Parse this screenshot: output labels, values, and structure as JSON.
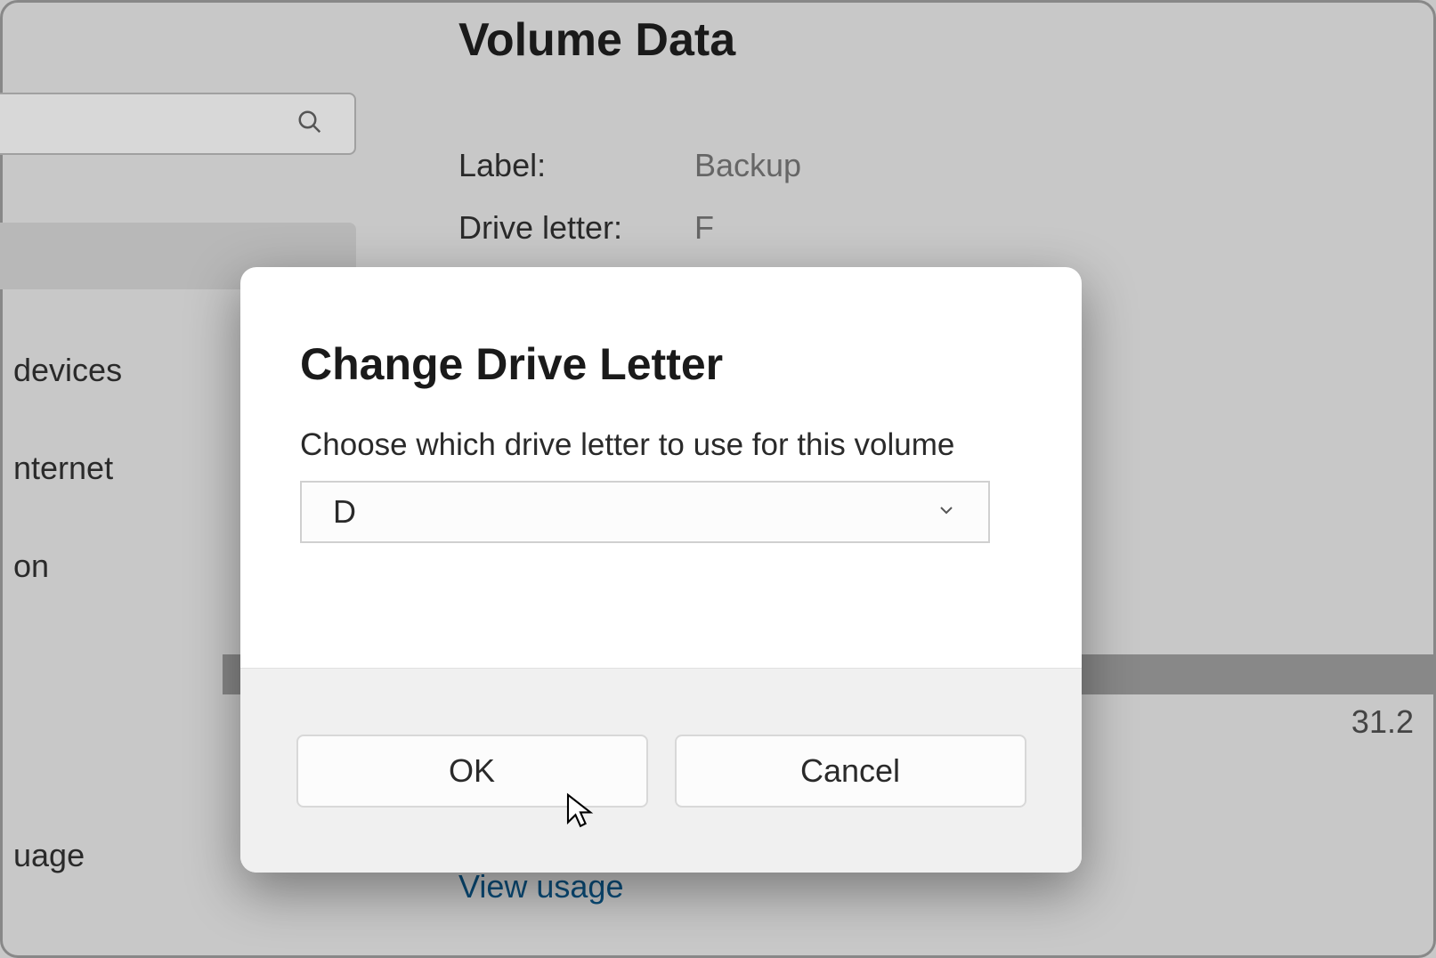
{
  "page": {
    "title": "Volume Data",
    "label_field": "Label:",
    "label_value": "Backup",
    "drive_letter_field": "Drive letter:",
    "drive_letter_value": "F",
    "view_usage_link": "View usage",
    "bg_number": "31.2"
  },
  "sidebar": {
    "item_devices": "devices",
    "item_internet": "nternet",
    "item_on": "on",
    "item_uage": "uage"
  },
  "dialog": {
    "title": "Change Drive Letter",
    "subtitle": "Choose which drive letter to use for this volume",
    "selected_value": "D",
    "ok_label": "OK",
    "cancel_label": "Cancel"
  }
}
